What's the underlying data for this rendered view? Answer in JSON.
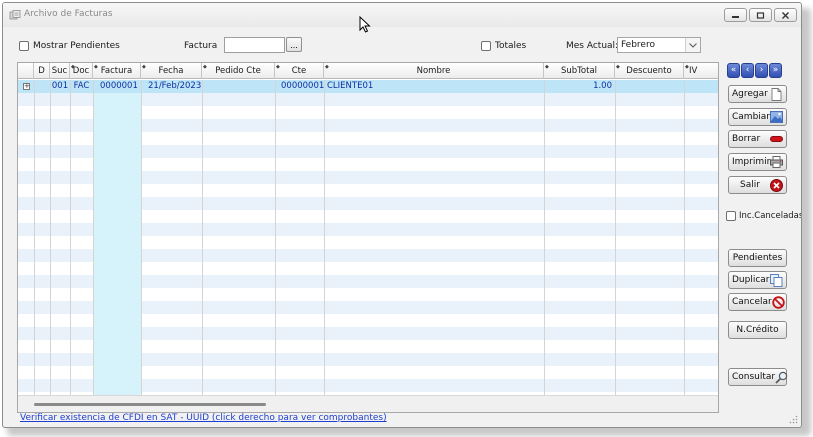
{
  "window": {
    "title": "Archivo de Facturas",
    "icon": "invoice-app-icon",
    "controls": [
      "minimize-icon",
      "restore-icon",
      "close-icon"
    ]
  },
  "filters": {
    "mostrar_pendientes_label": "Mostrar Pendientes",
    "mostrar_pendientes_checked": false,
    "factura_label": "Factura",
    "factura_value": "",
    "browse_label": "...",
    "totales_label": "Totales",
    "totales_checked": false,
    "mes_actual_label": "Mes Actual:",
    "mes_actual_value": "Febrero"
  },
  "grid": {
    "columns": [
      "D",
      "Suc",
      "Doc",
      "Factura",
      "Fecha",
      "Pedido Cte",
      "Cte",
      "Nombre",
      "SubTotal",
      "Descuento",
      "IV"
    ],
    "rows": [
      {
        "d": "",
        "suc": "001",
        "doc": "FAC",
        "factura": "0000001",
        "fecha": "21/Feb/2023",
        "pedido_cte": "",
        "cte": "00000001",
        "nombre": "CLIENTE01",
        "subtotal": "1.00",
        "descuento": "",
        "iv": ""
      }
    ]
  },
  "navigation": {
    "icons": [
      "first-record-icon",
      "previous-record-icon",
      "next-record-icon",
      "last-record-icon"
    ]
  },
  "actions": {
    "agregar": "Agregar",
    "cambiar": "Cambiar",
    "borrar": "Borrar",
    "imprimir": "Imprimir",
    "salir": "Salir",
    "inc_canceladas_label": "Inc.Canceladas",
    "inc_canceladas_checked": false,
    "pendientes": "Pendientes",
    "duplicar": "Duplicar",
    "cancelar": "Cancelar",
    "ncredito": "N.Crédito",
    "consultar": "Consultar"
  },
  "footer": {
    "link_text": "Verificar existencia de CFDI en SAT - UUID  (click derecho para ver comprobantes)"
  },
  "colors": {
    "accent_link": "#1f3fd0",
    "row_selected": "#bde4f7",
    "factura_column": "#d6f2fb",
    "row_stripe": "#e9f2fb",
    "cell_text": "#102fa0",
    "nav_button": "#3150b2"
  }
}
